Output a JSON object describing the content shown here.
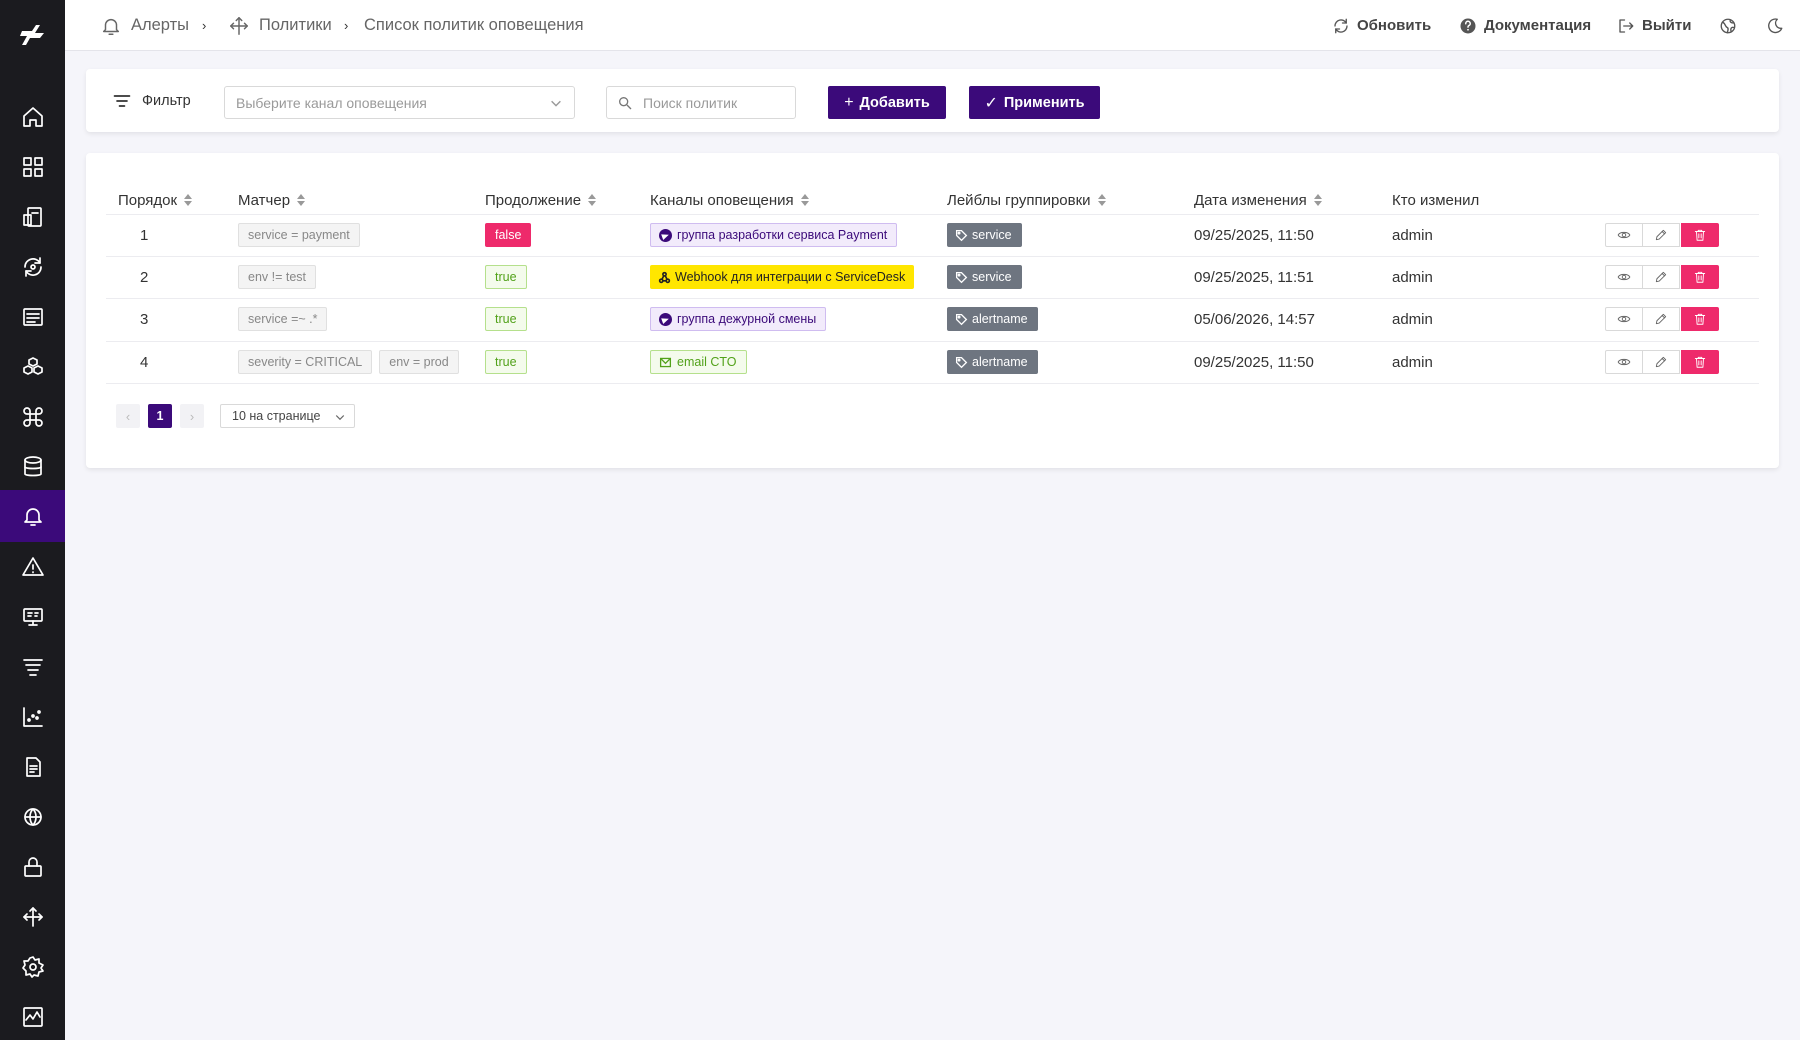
{
  "breadcrumb": {
    "alerts": "Алерты",
    "policies": "Политики",
    "current": "Список политик оповещения",
    "sep": "›"
  },
  "header": {
    "refresh": "Обновить",
    "docs": "Документация",
    "logout": "Выйти"
  },
  "filter": {
    "label": "Фильтр",
    "channel_placeholder": "Выберите канал оповещения",
    "search_placeholder": "Поиск политик",
    "add": "Добавить",
    "apply": "Применить"
  },
  "table": {
    "columns": [
      "Порядок",
      "Матчер",
      "Продолжение",
      "Каналы оповещения",
      "Лейблы группировки",
      "Дата изменения",
      "Кто изменил"
    ],
    "rows": [
      {
        "order": "1",
        "matchers": [
          "service = payment"
        ],
        "continue": "false",
        "channel": {
          "type": "telegram",
          "name": "группа разработки сервиса Payment"
        },
        "label": "service",
        "date": "09/25/2025, 11:50",
        "user": "admin"
      },
      {
        "order": "2",
        "matchers": [
          "env != test"
        ],
        "continue": "true",
        "channel": {
          "type": "webhook",
          "name": "Webhook для интеграции с ServiceDesk"
        },
        "label": "service",
        "date": "09/25/2025, 11:51",
        "user": "admin"
      },
      {
        "order": "3",
        "matchers": [
          "service =~ .*"
        ],
        "continue": "true",
        "channel": {
          "type": "telegram",
          "name": "группа дежурной смены"
        },
        "label": "alertname",
        "date": "05/06/2026, 14:57",
        "user": "admin"
      },
      {
        "order": "4",
        "matchers": [
          "severity = CRITICAL",
          "env = prod"
        ],
        "continue": "true",
        "channel": {
          "type": "email",
          "name": "email CTO"
        },
        "label": "alertname",
        "date": "09/25/2025, 11:50",
        "user": "admin"
      }
    ]
  },
  "pagination": {
    "prev": "‹",
    "current": "1",
    "next": "›",
    "page_size": "10 на странице"
  },
  "colors": {
    "primary": "#3b0a7a",
    "danger": "#ee2a6b",
    "sidebar": "#1b1b1f",
    "success": "#52a21a",
    "webhook": "#ffe600"
  },
  "sidebar_icons": [
    "home-icon",
    "dashboard-icon",
    "cost-icon",
    "sync-icon",
    "list-icon",
    "hexagons-icon",
    "command-icon",
    "database-icon",
    "bell-icon",
    "warning-icon",
    "monitor-icon",
    "filter-stack-icon",
    "scatter-chart-icon",
    "document-icon",
    "network-icon",
    "lock-icon",
    "route-icon",
    "gear-icon",
    "activity-icon"
  ]
}
